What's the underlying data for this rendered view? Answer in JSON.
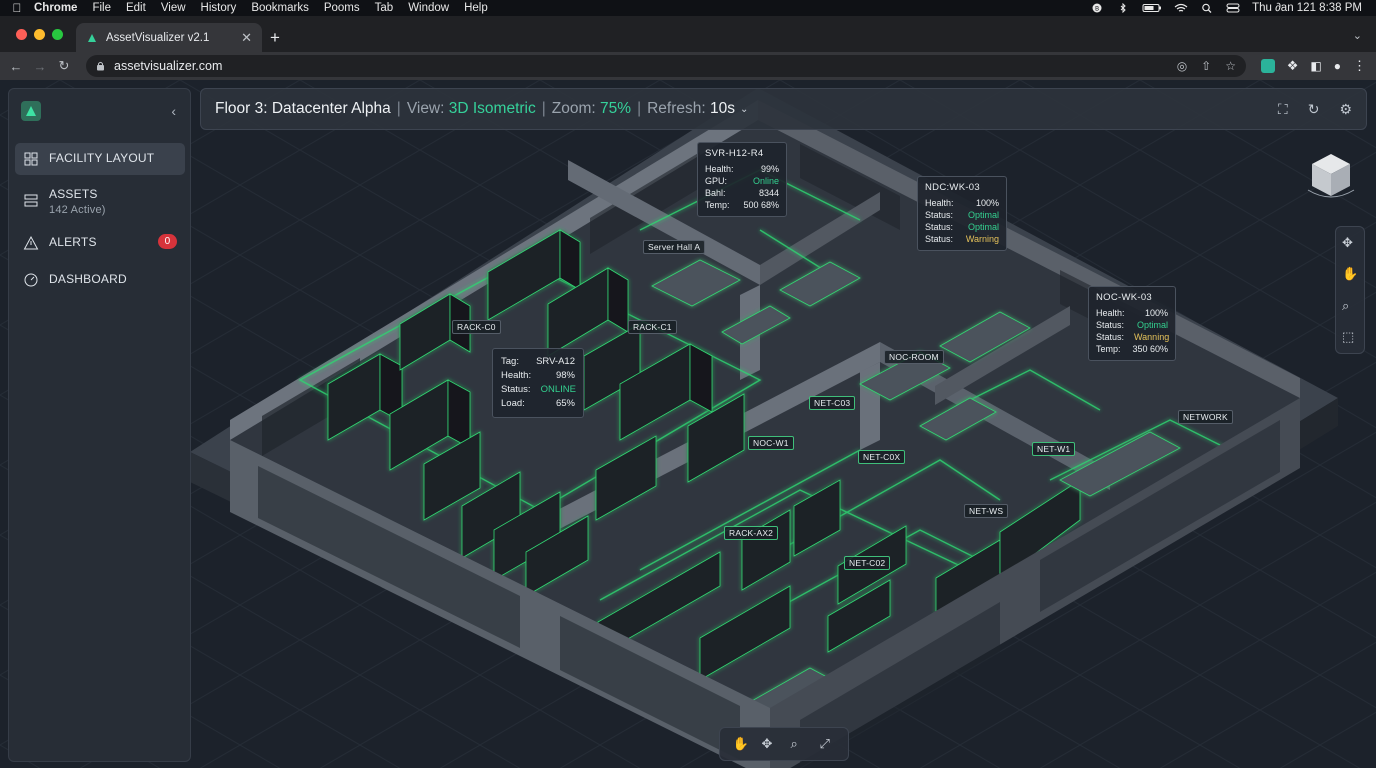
{
  "menubar": {
    "app": "Chrome",
    "items": [
      "File",
      "Edit",
      "View",
      "History",
      "Bookmarks",
      "Pooms",
      "Tab",
      "Window",
      "Help"
    ],
    "clock": "Thu ∂an 121  8:38 PM"
  },
  "browser": {
    "tab_title": "AssetVisualizer v2.1",
    "url": "assetvisualizer.com"
  },
  "sidebar": {
    "items": [
      {
        "label": "FACILITY LAYOUT",
        "icon": "grid-icon",
        "active": true
      },
      {
        "label": "ASSETS",
        "sub": "142 Active)",
        "icon": "server-icon"
      },
      {
        "label": "ALERTS",
        "icon": "alert-triangle-icon",
        "badge": "0"
      },
      {
        "label": "DASHBOARD",
        "icon": "gauge-icon"
      }
    ]
  },
  "header": {
    "floor": "Floor 3: Datacenter Alpha",
    "view_label": "View:",
    "view_value": "3D Isometric",
    "zoom_label": "Zoom:",
    "zoom_value": "75%",
    "refresh_label": "Refresh:",
    "refresh_value": "10s",
    "separator": "|"
  },
  "tooltips": {
    "srv_a12": {
      "rows": [
        [
          "Tag:",
          "SRV-A12"
        ],
        [
          "Health:",
          "98%"
        ],
        [
          "Status:",
          "ONLINE"
        ],
        [
          "Load:",
          "65%"
        ]
      ]
    },
    "svr_h12": {
      "title": "SVR-H12-R4",
      "rows": [
        [
          "Health:",
          "99%"
        ],
        [
          "GPU:",
          "Online"
        ],
        [
          "Bahl:",
          "8344"
        ],
        [
          "Temp:",
          "500 68%"
        ]
      ]
    },
    "noc_wk03a": {
      "title": "NDC:WK-03",
      "rows": [
        [
          "Health:",
          "100%"
        ],
        [
          "Status:",
          "Optimal"
        ],
        [
          "Status:",
          "Optimal"
        ],
        [
          "Status:",
          "Warning"
        ]
      ]
    },
    "noc_wk03b": {
      "title": "NOC-WK-03",
      "rows": [
        [
          "Health:",
          "100%"
        ],
        [
          "Status:",
          "Optimal"
        ],
        [
          "Status:",
          "Wanning"
        ],
        [
          "Temp:",
          "350 60%"
        ]
      ]
    }
  },
  "floor_labels": {
    "rack_a": "RACK-C0",
    "rack_b": "RACK-C1",
    "server_hall": "Server Hall A",
    "net_c03": "NET-C03",
    "noc_w1": "NOC-W1",
    "net_c0x": "NET-C0X",
    "rack_ax2": "RACK-AX2",
    "net_c02": "NET-C02",
    "net_w1": "NET-W1",
    "net_ws": "NET-WS",
    "noc_room": "NOC-ROOM",
    "network": "NETWORK"
  },
  "colors": {
    "accent_green": "#35d19a",
    "warning_yellow": "#e4c15a",
    "alert_red": "#d6333b"
  }
}
